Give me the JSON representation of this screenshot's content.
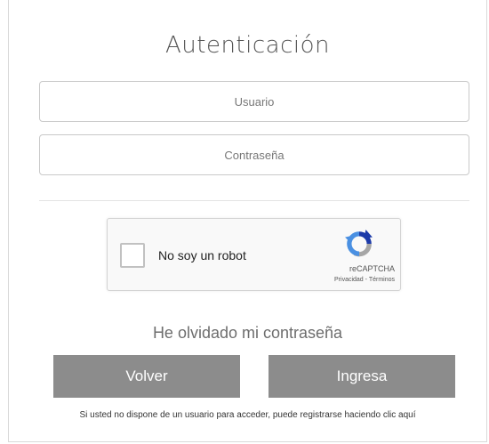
{
  "auth": {
    "title": "Autenticación",
    "username_placeholder": "Usuario",
    "username_value": "",
    "password_placeholder": "Contraseña",
    "password_value": ""
  },
  "captcha": {
    "checkbox_label": "No soy un robot",
    "brand": "reCAPTCHA",
    "privacy_link": "Privacidad",
    "separator": " - ",
    "terms_link": "Términos",
    "checked": false
  },
  "actions": {
    "forgot_password": "He olvidado mi contraseña",
    "back_button": "Volver",
    "submit_button": "Ingresa",
    "register_text": "Si usted no dispone de un usuario para acceder, puede registrarse haciendo clic aquí"
  },
  "colors": {
    "button_bg": "#8c8c8c",
    "title_text": "#555555",
    "recaptcha_blue": "#4a90e2",
    "recaptcha_gray": "#a6a6a6",
    "recaptcha_dark_blue": "#1c3aa9"
  },
  "icons": {
    "recaptcha": "recaptcha-logo-icon"
  }
}
